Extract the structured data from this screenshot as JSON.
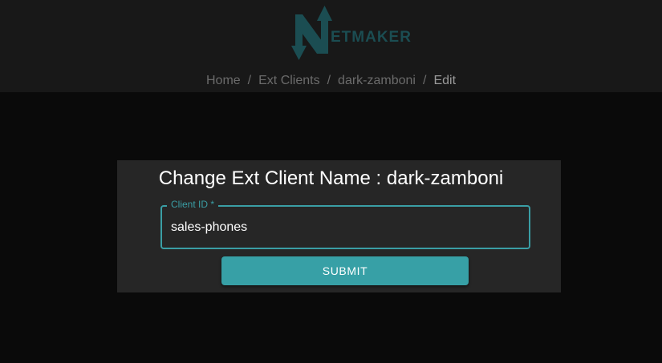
{
  "brand": {
    "logo_text": "ETMAKER",
    "logo_color": "#1b4d52"
  },
  "breadcrumb": {
    "items": [
      "Home",
      "Ext Clients",
      "dark-zamboni"
    ],
    "current": "Edit",
    "separator": "/"
  },
  "form": {
    "title": "Change Ext Client Name : dark-zamboni",
    "client_id_label": "Client ID *",
    "client_id_value": "sales-phones",
    "submit_label": "SUBMIT"
  },
  "colors": {
    "accent": "#37a0a6",
    "page_bg": "#0a0a0a",
    "header_bg": "#181818",
    "card_bg": "#262626"
  }
}
